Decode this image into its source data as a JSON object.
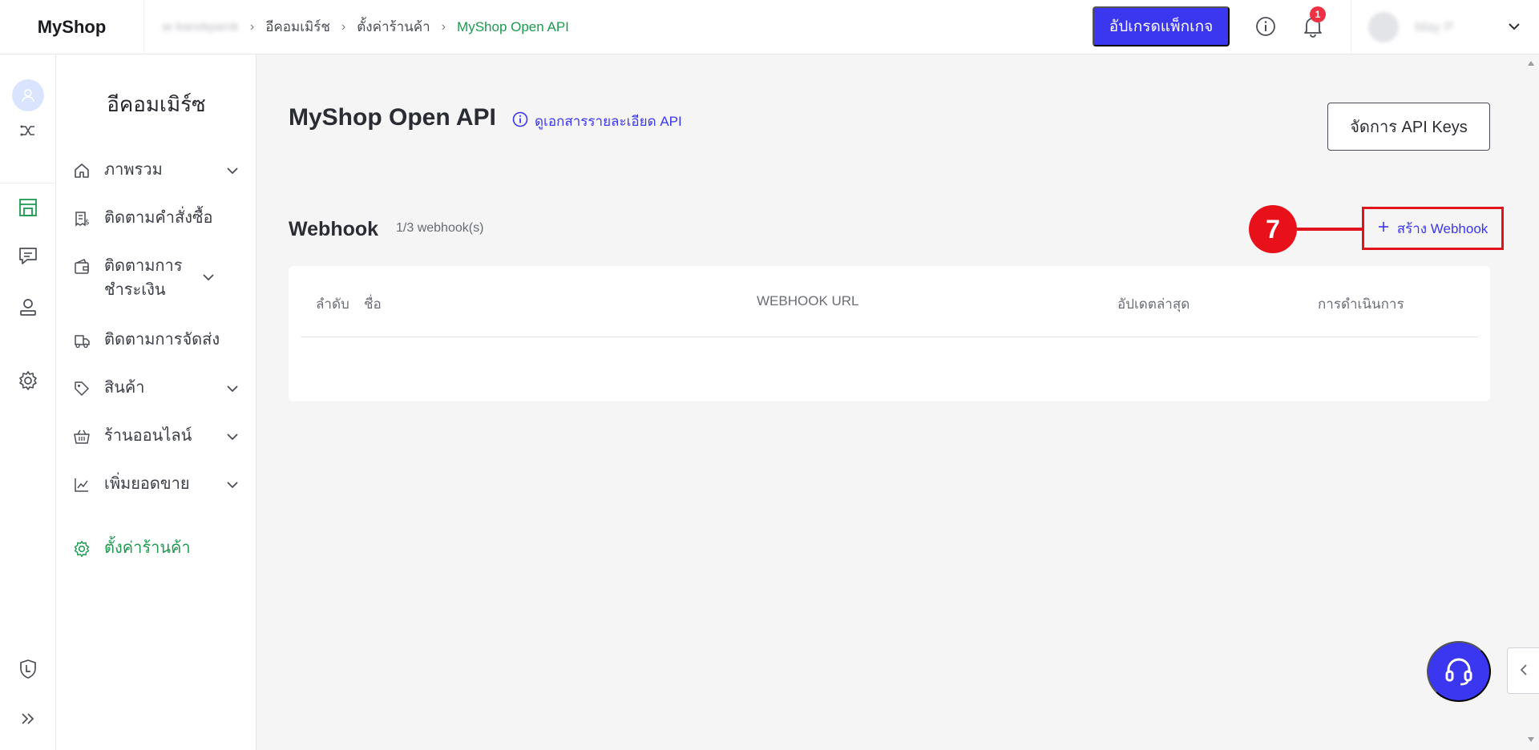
{
  "app": {
    "logo": "MyShop"
  },
  "breadcrumb": {
    "items": [
      "ar-kanokparnk",
      "อีคอมเมิร์ช",
      "ตั้งค่าร้านค้า",
      "MyShop Open API"
    ]
  },
  "header": {
    "upgrade_label": "อัปเกรดแพ็กเกจ",
    "notification_count": "1",
    "user_name": "May P"
  },
  "sidebar": {
    "title": "อีคอมเมิร์ซ",
    "items": [
      {
        "label": "ภาพรวม",
        "icon": "home-icon",
        "has_children": true
      },
      {
        "label": "ติดตามคำสั่งซื้อ",
        "icon": "receipt-icon",
        "has_children": false
      },
      {
        "label": "ติดตามการชำระเงิน",
        "icon": "wallet-icon",
        "has_children": true
      },
      {
        "label": "ติดตามการจัดส่ง",
        "icon": "truck-icon",
        "has_children": false
      },
      {
        "label": "สินค้า",
        "icon": "tag-icon",
        "has_children": true
      },
      {
        "label": "ร้านออนไลน์",
        "icon": "basket-icon",
        "has_children": true
      },
      {
        "label": "เพิ่มยอดขาย",
        "icon": "chart-icon",
        "has_children": true
      },
      {
        "label": "ตั้งค่าร้านค้า",
        "icon": "gear-icon",
        "has_children": false,
        "active": true
      }
    ]
  },
  "main": {
    "title": "MyShop Open API",
    "doc_link": "ดูเอกสารรายละเอียด API",
    "api_keys_button": "จัดการ API Keys",
    "webhook": {
      "title": "Webhook",
      "count": "1/3 webhook(s)",
      "create_button": "สร้าง Webhook",
      "step_number": "7"
    },
    "table": {
      "columns": [
        "ลำดับ",
        "ชื่อ",
        "WEBHOOK URL",
        "อัปเดตล่าสุด",
        "การดำเนินการ"
      ]
    }
  },
  "colors": {
    "accent": "#3b36f0",
    "active_green": "#1d9a4f",
    "highlight_red": "#e0141d"
  }
}
